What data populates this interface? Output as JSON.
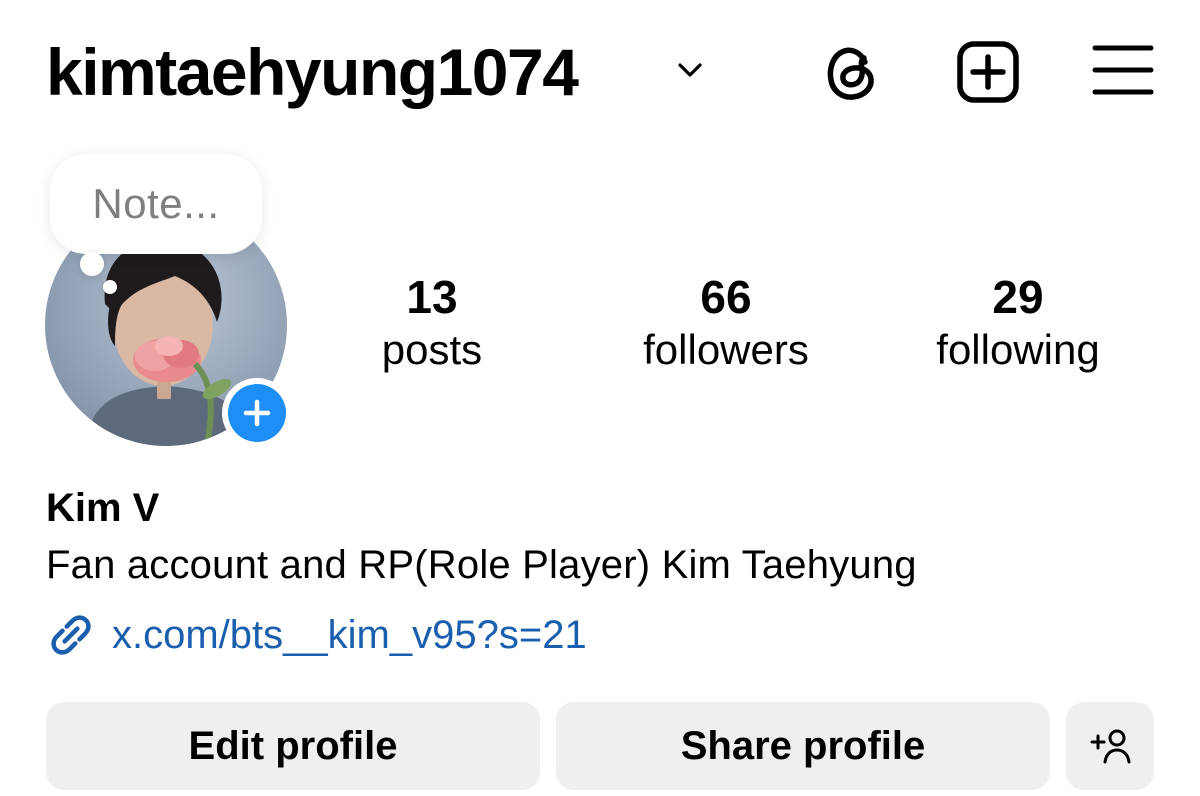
{
  "header": {
    "username": "kimtaehyung1074",
    "icons": [
      "chevron-down-icon",
      "threads-icon",
      "new-post-icon",
      "menu-icon"
    ]
  },
  "note": {
    "placeholder": "Note..."
  },
  "stats": {
    "posts": {
      "count": "13",
      "label": "posts"
    },
    "followers": {
      "count": "66",
      "label": "followers"
    },
    "following": {
      "count": "29",
      "label": "following"
    }
  },
  "bio": {
    "display_name": "Kim V",
    "text": "Fan account and RP(Role Player) Kim Taehyung",
    "link": "x.com/bts__kim_v95?s=21"
  },
  "actions": {
    "edit_label": "Edit profile",
    "share_label": "Share profile"
  },
  "colors": {
    "accent_blue": "#1d8ef5",
    "link_blue": "#1a5fae",
    "button_bg": "#efeff1",
    "muted_text": "#7f7f7f"
  }
}
